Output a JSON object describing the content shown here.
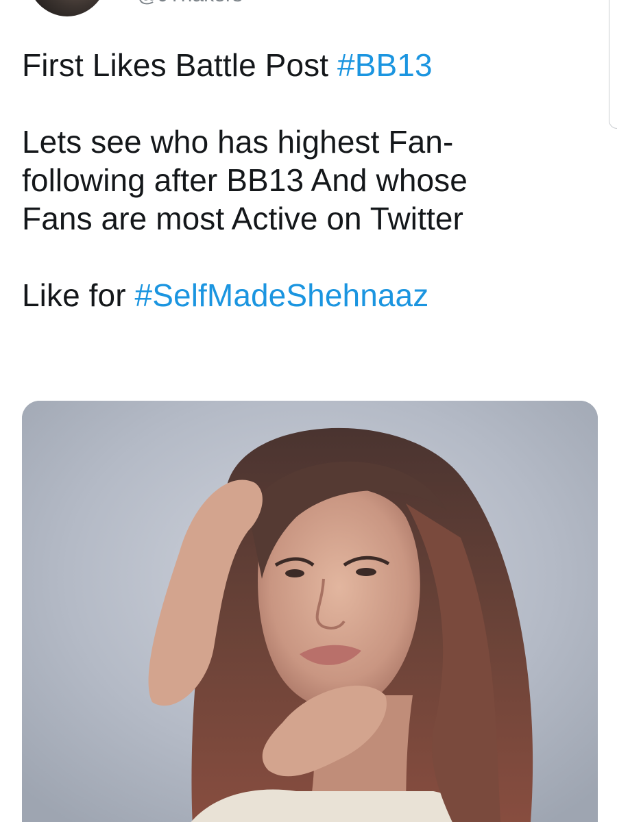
{
  "header": {
    "handle": "@JThakers"
  },
  "tweet": {
    "line1_text": "First Likes Battle Post",
    "line1_hashtag": "#BB13",
    "paragraph2_line1": "Lets see who has highest Fan-",
    "paragraph2_line2": "following after BB13 And whose",
    "paragraph2_line3": "Fans are most Active on Twitter",
    "line4_text": "Like for",
    "line4_hashtag": "#SelfMadeShehnaaz"
  },
  "media": {
    "type": "photo"
  },
  "colors": {
    "hashtag": "#1b95e0",
    "text": "#14171a",
    "handle": "#7b8288"
  }
}
